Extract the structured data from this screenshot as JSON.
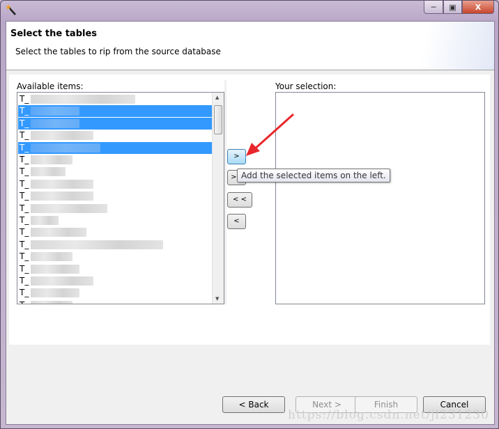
{
  "window": {
    "icon": "wizard-wand-icon",
    "controls": {
      "minimize": "minimize-icon",
      "maximize": "restore-icon",
      "close": "X"
    }
  },
  "banner": {
    "title": "Select the tables",
    "description": "Select the tables to rip from the source database"
  },
  "available": {
    "label": "Available items:",
    "items": [
      {
        "text": "T_",
        "selected": false
      },
      {
        "text": "T_",
        "selected": true
      },
      {
        "text": "T_",
        "selected": true
      },
      {
        "text": "T_",
        "selected": false
      },
      {
        "text": "T_",
        "selected": true
      },
      {
        "text": "T_",
        "selected": false
      },
      {
        "text": "T_",
        "selected": false
      },
      {
        "text": "T_",
        "selected": false
      },
      {
        "text": "T_",
        "selected": false
      },
      {
        "text": "T_",
        "selected": false
      },
      {
        "text": "T_",
        "selected": false
      },
      {
        "text": "T_",
        "selected": false
      },
      {
        "text": "T_",
        "selected": false
      },
      {
        "text": "T_",
        "selected": false
      },
      {
        "text": "T_",
        "selected": false
      },
      {
        "text": "T_",
        "selected": false
      },
      {
        "text": "T_",
        "selected": false
      },
      {
        "text": "T_",
        "selected": false
      }
    ]
  },
  "selection": {
    "label": "Your selection:",
    "items": []
  },
  "move_buttons": {
    "add": ">",
    "add_all": ">>",
    "remove_all": "< <",
    "remove": "<"
  },
  "tooltip": "Add the selected items on the left.",
  "footer": {
    "back": "< Back",
    "next": "Next >",
    "finish": "Finish",
    "cancel": "Cancel"
  },
  "watermark": "https://blog.csdn.net/jl231230",
  "colors": {
    "selection": "#3399ff",
    "annotation_arrow": "#e8262b"
  }
}
